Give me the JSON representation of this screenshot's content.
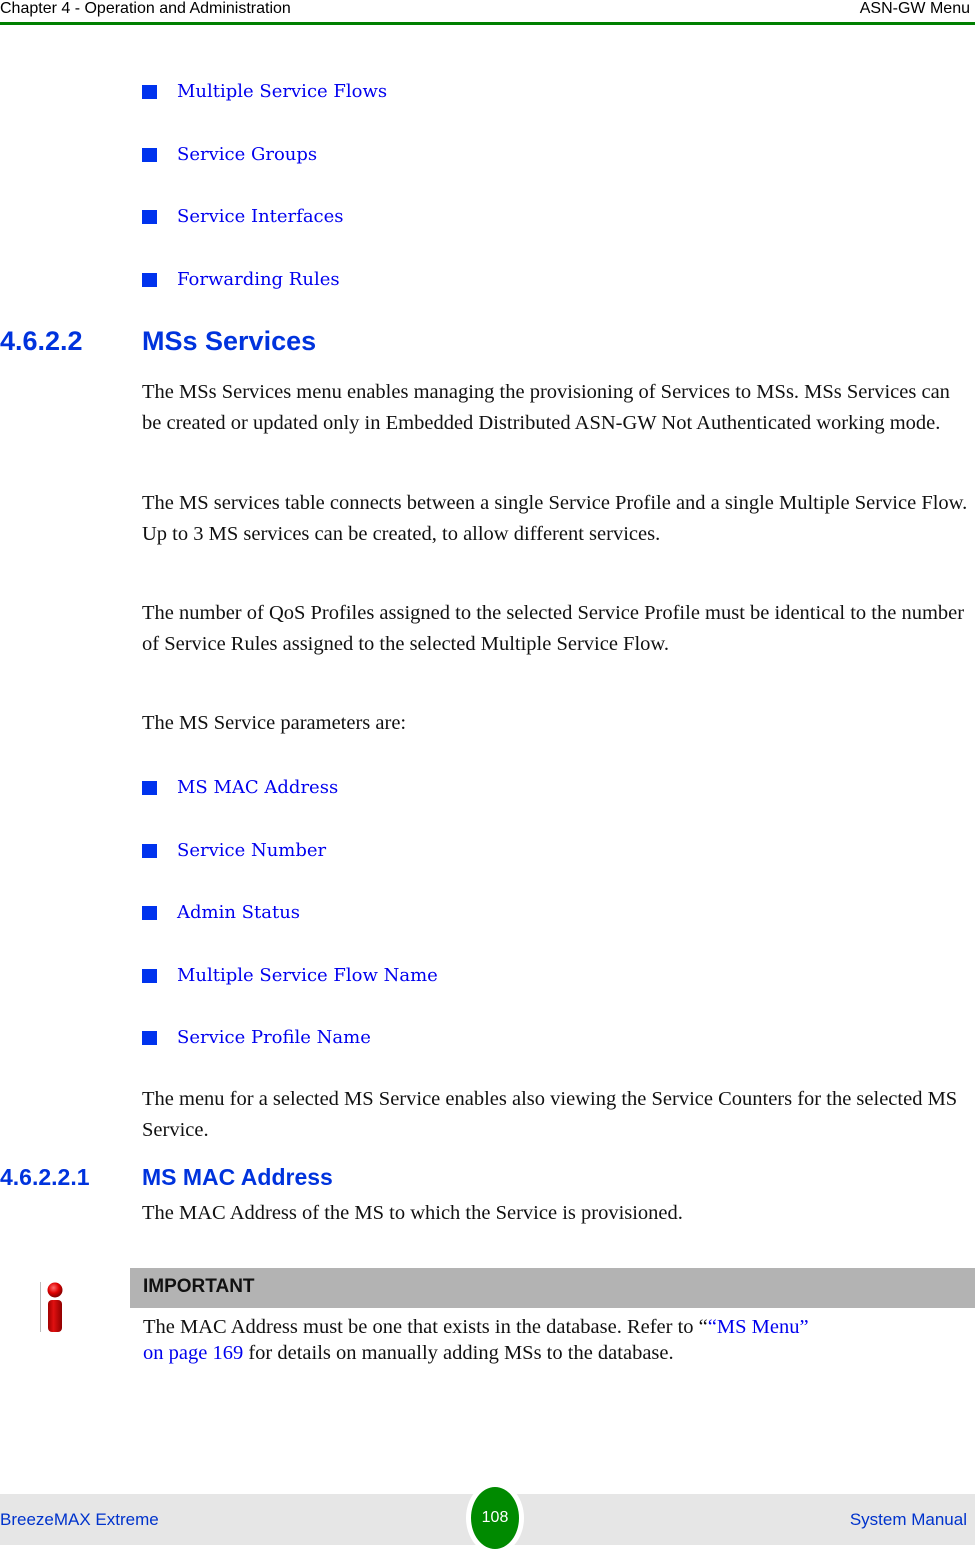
{
  "header": {
    "chapter": "Chapter 4 - Operation and Administration",
    "section": "ASN-GW Menu"
  },
  "top_list": [
    "Multiple Service Flows",
    "Service Groups",
    "Service Interfaces",
    "Forwarding Rules"
  ],
  "section": {
    "number": "4.6.2.2",
    "title": "MSs Services",
    "paragraphs": [
      "The MSs Services menu enables managing the provisioning of Services to MSs. MSs Services can be created or updated only in Embedded Distributed ASN-GW Not Authenticated working mode.",
      "The MS services table connects between a single Service Profile and a single Multiple Service Flow. Up to 3 MS services can be created, to allow different services.",
      "The number of QoS Profiles assigned to the selected Service Profile must be identical to the number of Service Rules assigned to the selected Multiple Service Flow.",
      "The MS Service parameters are:"
    ],
    "parameters": [
      "MS MAC Address",
      "Service Number",
      "Admin Status",
      "Multiple Service Flow Name",
      "Service Profile Name"
    ],
    "closing": "The menu for a selected MS Service enables also viewing the Service Counters for the selected MS Service."
  },
  "subsection": {
    "number": "4.6.2.2.1",
    "title": "MS MAC Address",
    "text": "The MAC Address of the MS to which the Service is provisioned."
  },
  "note": {
    "icon": "info-icon",
    "label": "IMPORTANT",
    "text_before": "The MAC Address must be one that exists in the database. Refer to “",
    "link_text_1": "“MS Menu”",
    "link_text_2": "on page 169",
    "text_after": " for details on manually adding MSs to the database."
  },
  "footer": {
    "product": "BreezeMAX Extreme",
    "page": "108",
    "doc": "System Manual"
  },
  "colors": {
    "accent_green": "#008000",
    "link_blue": "#0000ee",
    "heading_blue": "#0033dd"
  }
}
